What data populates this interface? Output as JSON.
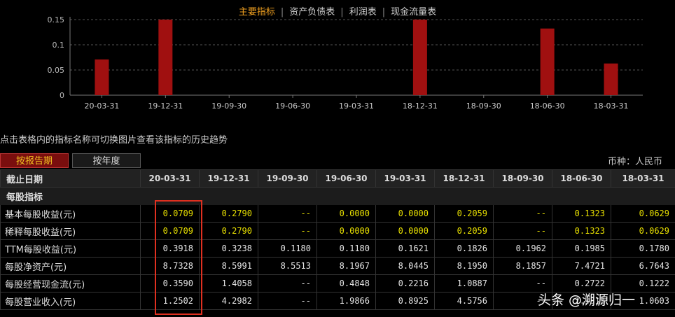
{
  "tabs": [
    "主要指标",
    "资产负债表",
    "利润表",
    "现金流量表"
  ],
  "chart_data": {
    "type": "bar",
    "categories": [
      "20-03-31",
      "19-12-31",
      "19-09-30",
      "19-06-30",
      "19-03-31",
      "18-12-31",
      "18-09-30",
      "18-06-30",
      "18-03-31"
    ],
    "values": [
      0.0709,
      0.279,
      null,
      0.0,
      0.0,
      0.2059,
      null,
      0.1323,
      0.0629
    ],
    "yticks": [
      "0",
      "0.05",
      "0.1",
      "0.15"
    ],
    "ylim": [
      0,
      0.15
    ],
    "bar_color": "#a01010",
    "grid": true
  },
  "hint": "点击表格内的指标名称可切换图片查看该指标的历史趋势",
  "buttons": {
    "by_report": "按报告期",
    "by_year": "按年度"
  },
  "currency": "币种：人民币",
  "table": {
    "header_label": "截止日期",
    "dates": [
      "20-03-31",
      "19-12-31",
      "19-09-30",
      "19-06-30",
      "19-03-31",
      "18-12-31",
      "18-09-30",
      "18-06-30",
      "18-03-31"
    ],
    "section": "每股指标",
    "rows": [
      {
        "label": "基本每股收益(元)",
        "values": [
          "0.0709",
          "0.2790",
          "--",
          "0.0000",
          "0.0000",
          "0.2059",
          "--",
          "0.1323",
          "0.0629"
        ]
      },
      {
        "label": "稀释每股收益(元)",
        "values": [
          "0.0709",
          "0.2790",
          "--",
          "0.0000",
          "0.0000",
          "0.2059",
          "--",
          "0.1323",
          "0.0629"
        ]
      },
      {
        "label": "TTM每股收益(元)",
        "values": [
          "0.3918",
          "0.3238",
          "0.1180",
          "0.1180",
          "0.1621",
          "0.1826",
          "0.1962",
          "0.1985",
          "0.1780"
        ]
      },
      {
        "label": "每股净资产(元)",
        "values": [
          "8.7328",
          "8.5991",
          "8.5513",
          "8.1967",
          "8.0445",
          "8.1950",
          "8.1857",
          "7.4721",
          "6.7643"
        ]
      },
      {
        "label": "每股经营现金流(元)",
        "values": [
          "0.3590",
          "1.4058",
          "--",
          "0.4848",
          "0.2216",
          "1.0887",
          "--",
          "0.2722",
          "0.1222"
        ]
      },
      {
        "label": "每股营业收入(元)",
        "values": [
          "1.2502",
          "4.2982",
          "--",
          "1.9866",
          "0.8925",
          "4.5756",
          "--",
          "2.3313",
          "1.0603"
        ]
      }
    ]
  },
  "watermark": "头条 @溯源归一"
}
